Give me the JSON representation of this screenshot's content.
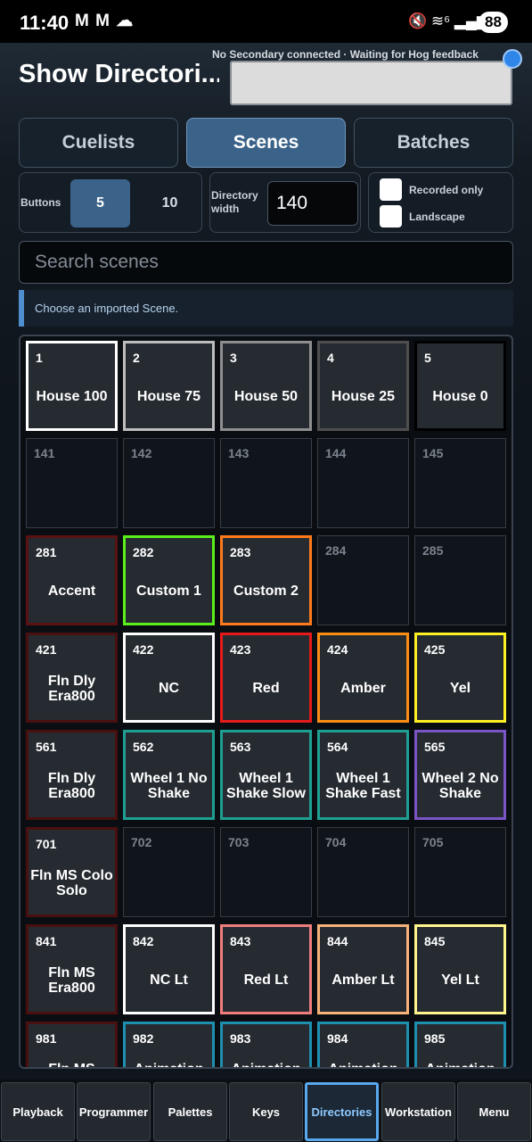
{
  "status_bar": {
    "time": "11:40",
    "notif_icons": "M M ☁",
    "right_icons": "🔇 ≋⁶ ▂▄▆",
    "battery": "88"
  },
  "header": {
    "title": "Show Directori...",
    "connection_status": "No Secondary connected · Waiting for Hog feedback"
  },
  "tabs": [
    {
      "label": "Cuelists",
      "active": false
    },
    {
      "label": "Scenes",
      "active": true
    },
    {
      "label": "Batches",
      "active": false
    }
  ],
  "options": {
    "buttons_label": "Buttons",
    "button_choices": [
      "5",
      "10"
    ],
    "selected_button": "5",
    "directory_width_label": "Directory width",
    "directory_width_value": "140",
    "recorded_only_label": "Recorded only",
    "landscape_label": "Landscape"
  },
  "search": {
    "placeholder": "Search scenes"
  },
  "info_message": "Choose an imported Scene.",
  "scene_grid": [
    [
      {
        "num": "1",
        "name": "House 100",
        "color": "#ffffff"
      },
      {
        "num": "2",
        "name": "House 75",
        "color": "#bdbdbd"
      },
      {
        "num": "3",
        "name": "House 50",
        "color": "#8e8e8e"
      },
      {
        "num": "4",
        "name": "House 25",
        "color": "#4e4e4e"
      },
      {
        "num": "5",
        "name": "House 0",
        "color": "#000000"
      }
    ],
    [
      {
        "num": "141",
        "name": "",
        "color": ""
      },
      {
        "num": "142",
        "name": "",
        "color": ""
      },
      {
        "num": "143",
        "name": "",
        "color": ""
      },
      {
        "num": "144",
        "name": "",
        "color": ""
      },
      {
        "num": "145",
        "name": "",
        "color": ""
      }
    ],
    [
      {
        "num": "281",
        "name": "Accent",
        "color": "#5a1111"
      },
      {
        "num": "282",
        "name": "Custom 1",
        "color": "#5bf019"
      },
      {
        "num": "283",
        "name": "Custom 2",
        "color": "#ff7a1a"
      },
      {
        "num": "284",
        "name": "",
        "color": ""
      },
      {
        "num": "285",
        "name": "",
        "color": ""
      }
    ],
    [
      {
        "num": "421",
        "name": "Fln Dly Era800",
        "color": "#4a1010"
      },
      {
        "num": "422",
        "name": "NC",
        "color": "#ffffff"
      },
      {
        "num": "423",
        "name": "Red",
        "color": "#e51b1b"
      },
      {
        "num": "424",
        "name": "Amber",
        "color": "#ff8c14"
      },
      {
        "num": "425",
        "name": "Yel",
        "color": "#fff024"
      }
    ],
    [
      {
        "num": "561",
        "name": "Fln Dly Era800",
        "color": "#4a1010"
      },
      {
        "num": "562",
        "name": "Wheel 1 No Shake",
        "color": "#1f9e92"
      },
      {
        "num": "563",
        "name": "Wheel 1 Shake Slow",
        "color": "#1f9e92"
      },
      {
        "num": "564",
        "name": "Wheel 1 Shake Fast",
        "color": "#1f9e92"
      },
      {
        "num": "565",
        "name": "Wheel 2 No Shake",
        "color": "#7b55c6"
      }
    ],
    [
      {
        "num": "701",
        "name": "Fln MS Colo Solo",
        "color": "#4a1010"
      },
      {
        "num": "702",
        "name": "",
        "color": ""
      },
      {
        "num": "703",
        "name": "",
        "color": ""
      },
      {
        "num": "704",
        "name": "",
        "color": ""
      },
      {
        "num": "705",
        "name": "",
        "color": ""
      }
    ],
    [
      {
        "num": "841",
        "name": "Fln MS Era800",
        "color": "#4a1010"
      },
      {
        "num": "842",
        "name": "NC Lt",
        "color": "#ffffff"
      },
      {
        "num": "843",
        "name": "Red Lt",
        "color": "#f07d7d"
      },
      {
        "num": "844",
        "name": "Amber Lt",
        "color": "#f7b279"
      },
      {
        "num": "845",
        "name": "Yel Lt",
        "color": "#fff58c"
      }
    ],
    [
      {
        "num": "981",
        "name": "Fln MS",
        "color": "#4a1010"
      },
      {
        "num": "982",
        "name": "Animation",
        "color": "#1f8fb0"
      },
      {
        "num": "983",
        "name": "Animation",
        "color": "#1f8fb0"
      },
      {
        "num": "984",
        "name": "Animation",
        "color": "#1f8fb0"
      },
      {
        "num": "985",
        "name": "Animation",
        "color": "#1f8fb0"
      }
    ]
  ],
  "bottom_nav": [
    {
      "label": "Playback",
      "active": false
    },
    {
      "label": "Programmer",
      "active": false
    },
    {
      "label": "Palettes",
      "active": false
    },
    {
      "label": "Keys",
      "active": false
    },
    {
      "label": "Directories",
      "active": true
    },
    {
      "label": "Workstation",
      "active": false
    },
    {
      "label": "Menu",
      "active": false
    }
  ]
}
